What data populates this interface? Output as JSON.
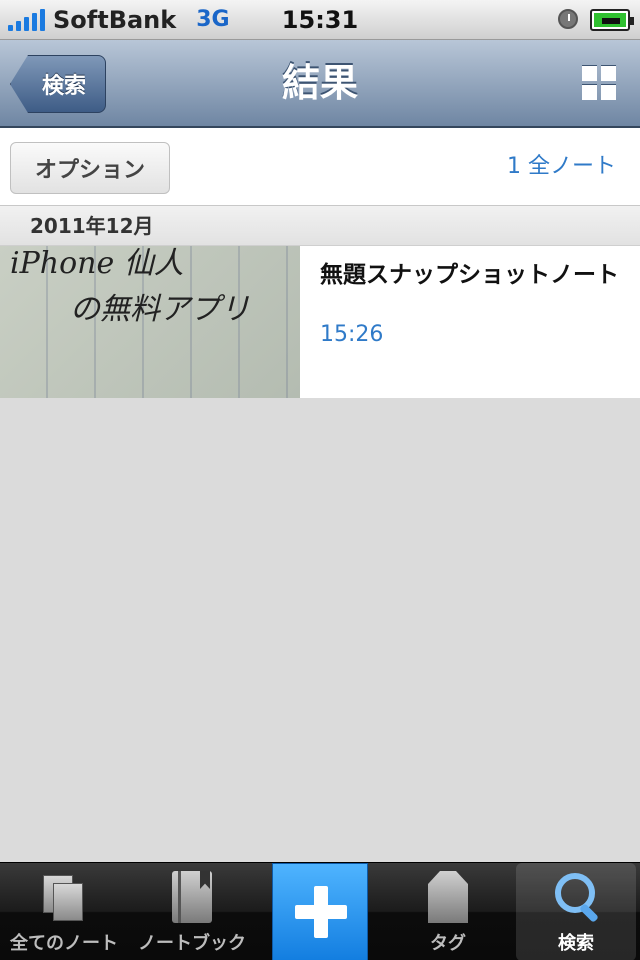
{
  "status_bar": {
    "carrier": "SoftBank",
    "network": "3G",
    "time": "15:31"
  },
  "nav": {
    "back_label": "検索",
    "title": "結果"
  },
  "options": {
    "button_label": "オプション",
    "count_label": "1 全ノート"
  },
  "section": {
    "header": "2011年12月"
  },
  "notes": [
    {
      "thumb_line1": "iPhone 仙人",
      "thumb_line2": "の無料アプリ",
      "title": "無題スナップショットノート",
      "time": "15:26"
    }
  ],
  "tabs": {
    "all_notes": "全てのノート",
    "notebooks": "ノートブック",
    "tags": "タグ",
    "search": "検索"
  }
}
